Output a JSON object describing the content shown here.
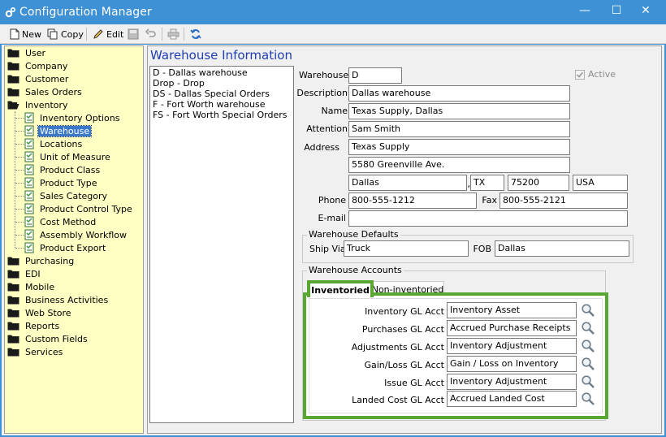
{
  "window": {
    "title": "Configuration Manager",
    "minimize": "—",
    "maximize": "☐",
    "close": "✕"
  },
  "toolbar": {
    "new_label": "New",
    "copy_label": "Copy",
    "edit_label": "Edit"
  },
  "sidebar": {
    "items": [
      {
        "label": "User"
      },
      {
        "label": "Company"
      },
      {
        "label": "Customer"
      },
      {
        "label": "Sales Orders"
      },
      {
        "label": "Inventory"
      },
      {
        "label": "Inventory Options"
      },
      {
        "label": "Warehouse"
      },
      {
        "label": "Locations"
      },
      {
        "label": "Unit of Measure"
      },
      {
        "label": "Product Class"
      },
      {
        "label": "Product Type"
      },
      {
        "label": "Sales Category"
      },
      {
        "label": "Product Control Type"
      },
      {
        "label": "Cost Method"
      },
      {
        "label": "Assembly Workflow"
      },
      {
        "label": "Product Export"
      },
      {
        "label": "Purchasing"
      },
      {
        "label": "EDI"
      },
      {
        "label": "Mobile"
      },
      {
        "label": "Business Activities"
      },
      {
        "label": "Web Store"
      },
      {
        "label": "Reports"
      },
      {
        "label": "Custom Fields"
      },
      {
        "label": "Services"
      }
    ]
  },
  "main": {
    "title": "Warehouse Information",
    "warehouses": [
      "D - Dallas warehouse",
      "Drop - Drop",
      "DS - Dallas Special Orders",
      "F - Fort Worth warehouse",
      "FS - Fort Worth Special Orders"
    ],
    "form": {
      "warehouse_label": "Warehouse",
      "warehouse_value": "D",
      "active_label": "Active",
      "description_label": "Description",
      "description_value": "Dallas warehouse",
      "name_label": "Name",
      "name_value": "Texas Supply, Dallas",
      "attention_label": "Attention",
      "attention_value": "Sam Smith",
      "address_label": "Address",
      "address1_value": "Texas Supply",
      "address2_value": "5580 Greenville Ave.",
      "city_value": "Dallas",
      "comma": ",",
      "state_value": "TX",
      "zip_value": "75200",
      "country_value": "USA",
      "phone_label": "Phone",
      "phone_value": "800-555-1212",
      "fax_label": "Fax",
      "fax_value": "800-555-2121",
      "email_label": "E-mail",
      "email_value": ""
    },
    "defaults": {
      "group_title": "Warehouse Defaults",
      "shipvia_label": "Ship Via",
      "shipvia_value": "Truck",
      "fob_label": "FOB",
      "fob_value": "Dallas"
    },
    "accounts": {
      "group_title": "Warehouse Accounts",
      "tabs": [
        "Inventoried",
        "Non-inventoried"
      ],
      "rows": [
        {
          "label": "Inventory GL Acct",
          "value": "Inventory Asset"
        },
        {
          "label": "Purchases GL Acct",
          "value": "Accrued Purchase Receipts"
        },
        {
          "label": "Adjustments GL Acct",
          "value": "Inventory Adjustment"
        },
        {
          "label": "Gain/Loss GL Acct",
          "value": "Gain / Loss on Inventory"
        },
        {
          "label": "Issue GL Acct",
          "value": "Inventory Adjustment"
        },
        {
          "label": "Landed Cost GL Acct",
          "value": "Accrued Landed Cost"
        }
      ]
    }
  },
  "colors": {
    "title_bar": "#3d91d4",
    "sidebar_bg": "#ffffc4",
    "selection": "#3a79c9",
    "highlight_border": "#5aa632",
    "heading": "#1f3fb3"
  }
}
